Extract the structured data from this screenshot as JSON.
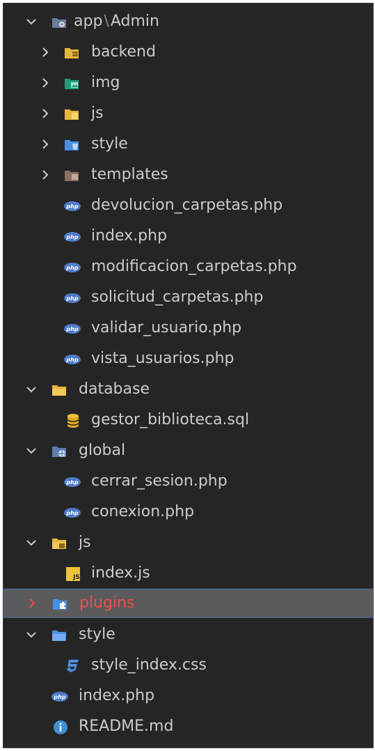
{
  "explorer": {
    "root": {
      "name": "app",
      "sep": "\\",
      "sub": "Admin"
    },
    "rows": [
      {
        "label": "backend"
      },
      {
        "label": "img"
      },
      {
        "label": "js"
      },
      {
        "label": "style"
      },
      {
        "label": "templates"
      },
      {
        "label": "devolucion_carpetas.php"
      },
      {
        "label": "index.php"
      },
      {
        "label": "modificacion_carpetas.php"
      },
      {
        "label": "solicitud_carpetas.php"
      },
      {
        "label": "validar_usuario.php"
      },
      {
        "label": "vista_usuarios.php"
      },
      {
        "label": "database"
      },
      {
        "label": "gestor_biblioteca.sql"
      },
      {
        "label": "global"
      },
      {
        "label": "cerrar_sesion.php"
      },
      {
        "label": "conexion.php"
      },
      {
        "label": "js"
      },
      {
        "label": "index.js"
      },
      {
        "label": "plugins"
      },
      {
        "label": "style"
      },
      {
        "label": "style_index.css"
      },
      {
        "label": "index.php"
      },
      {
        "label": "README.md"
      }
    ],
    "icon_text": {
      "js_badge": "JS",
      "php_badge": "php"
    },
    "colors": {
      "background": "#252526",
      "text": "#cccccc",
      "selected_bg": "#5b5b5b",
      "selected_text": "#f14c4c",
      "php_icon": "#4f7bc8",
      "folder_yellow": "#e8b53c",
      "folder_blue": "#4a90e2",
      "info_icon": "#3d8fd6"
    }
  }
}
